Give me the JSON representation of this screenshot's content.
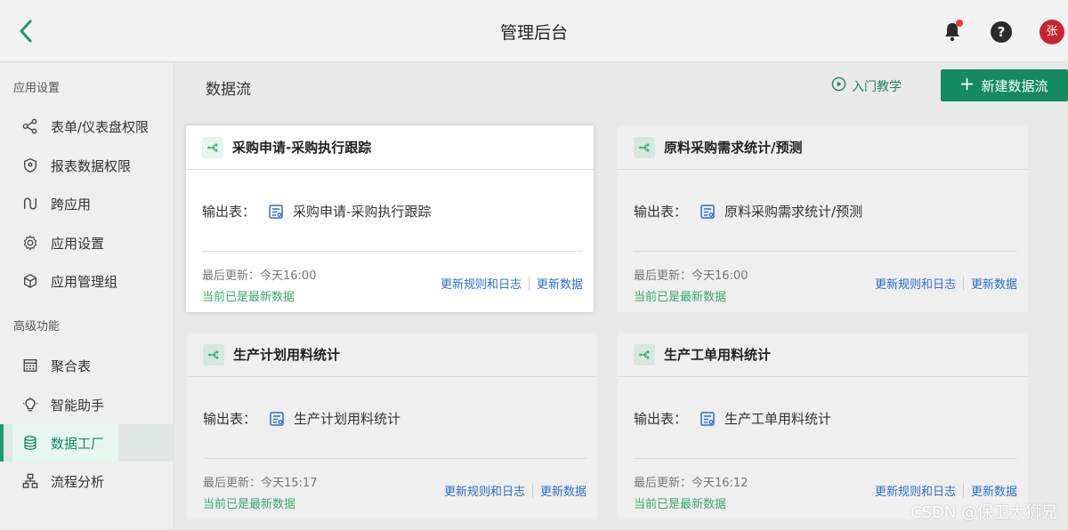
{
  "header": {
    "title": "管理后台",
    "avatar_text": "张",
    "help_text": "?",
    "accent": "#1a9b6e",
    "notification_dot": "#e53935"
  },
  "sidebar": {
    "sections": [
      {
        "title": "应用设置",
        "items": [
          {
            "label": "表单/仪表盘权限",
            "icon": "share-nodes-icon"
          },
          {
            "label": "报表数据权限",
            "icon": "shield-icon"
          },
          {
            "label": "跨应用",
            "icon": "link-curve-icon"
          },
          {
            "label": "应用设置",
            "icon": "gear-icon"
          },
          {
            "label": "应用管理组",
            "icon": "cube-icon"
          }
        ]
      },
      {
        "title": "高级功能",
        "items": [
          {
            "label": "聚合表",
            "icon": "grid-table-icon"
          },
          {
            "label": "智能助手",
            "icon": "lightbulb-icon"
          },
          {
            "label": "数据工厂",
            "icon": "database-icon",
            "active": true
          },
          {
            "label": "流程分析",
            "icon": "org-chart-icon"
          }
        ]
      }
    ]
  },
  "main": {
    "title": "数据流",
    "tutorial_label": "入门教学",
    "new_button_label": "新建数据流",
    "cards": [
      {
        "title": "采购申请-采购执行跟踪",
        "output_label": "输出表：",
        "output_table": "采购申请-采购执行跟踪",
        "updated": "最后更新：今天16:00",
        "status": "当前已是最新数据",
        "rule_link": "更新规则和日志",
        "update_link": "更新数据"
      },
      {
        "title": "原料采购需求统计/预测",
        "output_label": "输出表：",
        "output_table": "原料采购需求统计/预测",
        "updated": "最后更新：今天16:00",
        "status": "当前已是最新数据",
        "rule_link": "更新规则和日志",
        "update_link": "更新数据"
      },
      {
        "title": "生产计划用料统计",
        "output_label": "输出表：",
        "output_table": "生产计划用料统计",
        "updated": "最后更新：今天15:17",
        "status": "当前已是最新数据",
        "rule_link": "更新规则和日志",
        "update_link": "更新数据"
      },
      {
        "title": "生产工单用料统计",
        "output_label": "输出表：",
        "output_table": "生产工单用料统计",
        "updated": "最后更新：今天16:12",
        "status": "当前已是最新数据",
        "rule_link": "更新规则和日志",
        "update_link": "更新数据"
      }
    ]
  },
  "watermark": "CSDN @保卫大狮兄"
}
